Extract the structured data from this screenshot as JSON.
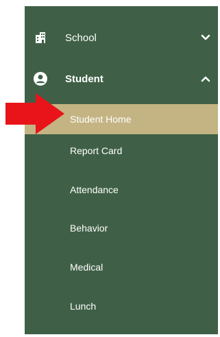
{
  "sidebar": {
    "groups": [
      {
        "label": "School",
        "icon": "building-icon",
        "expanded": false
      },
      {
        "label": "Student",
        "icon": "user-circle-icon",
        "expanded": true
      }
    ],
    "student_items": [
      {
        "label": "Student Home",
        "active": true
      },
      {
        "label": "Report Card",
        "active": false
      },
      {
        "label": "Attendance",
        "active": false
      },
      {
        "label": "Behavior",
        "active": false
      },
      {
        "label": "Medical",
        "active": false
      },
      {
        "label": "Lunch",
        "active": false
      }
    ]
  },
  "colors": {
    "sidebar_bg": "#3f6046",
    "active_bg": "#c4b483",
    "text": "#ffffff",
    "arrow": "#e8141a"
  },
  "annotation": {
    "icon": "red-arrow-icon"
  }
}
